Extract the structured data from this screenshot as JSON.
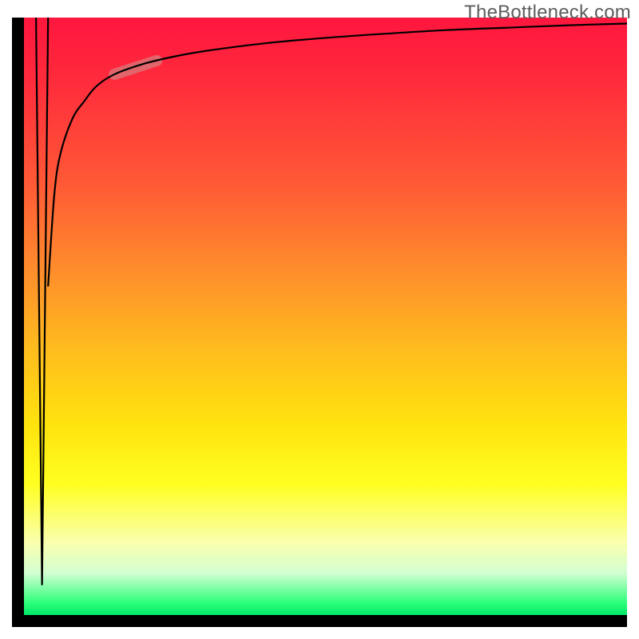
{
  "watermark": {
    "text": "TheBottleneck.com"
  },
  "colors": {
    "axis": "#000000",
    "curve": "#000000",
    "highlight": "#d9797a",
    "gradient_stops": [
      "#ff163e",
      "#ff2a3c",
      "#ff5a36",
      "#ff8c2c",
      "#ffba1e",
      "#ffe30e",
      "#ffff20",
      "#faffb0",
      "#d2ffd2",
      "#2cff7a",
      "#00e866"
    ]
  },
  "chart_data": {
    "type": "line",
    "title": "",
    "xlabel": "",
    "ylabel": "",
    "xlim": [
      0,
      100
    ],
    "ylim": [
      0,
      100
    ],
    "grid": false,
    "legend": false,
    "series": [
      {
        "name": "down-spike",
        "x": [
          2.0,
          3.0,
          4.0
        ],
        "y": [
          100,
          5,
          100
        ],
        "note": "Sharp vertical dip near the left axis that goes from top to near bottom and back up."
      },
      {
        "name": "main-curve",
        "x": [
          4,
          5,
          6,
          8,
          10,
          12,
          15,
          20,
          25,
          30,
          40,
          50,
          60,
          70,
          80,
          90,
          100
        ],
        "y": [
          55,
          70,
          77,
          83,
          86,
          88.5,
          90.5,
          92.3,
          93.5,
          94.4,
          95.7,
          96.6,
          97.3,
          97.9,
          98.3,
          98.7,
          99.0
        ],
        "note": "Steep-rising curve that flattens toward the top; y is percent-of-height from bottom."
      }
    ],
    "highlight_segment": {
      "on_series": "main-curve",
      "x_range": [
        15,
        22
      ],
      "y_range": [
        90,
        92.5
      ],
      "note": "Short pale-red capsule overlaid on the curve in the upper-left region."
    }
  }
}
